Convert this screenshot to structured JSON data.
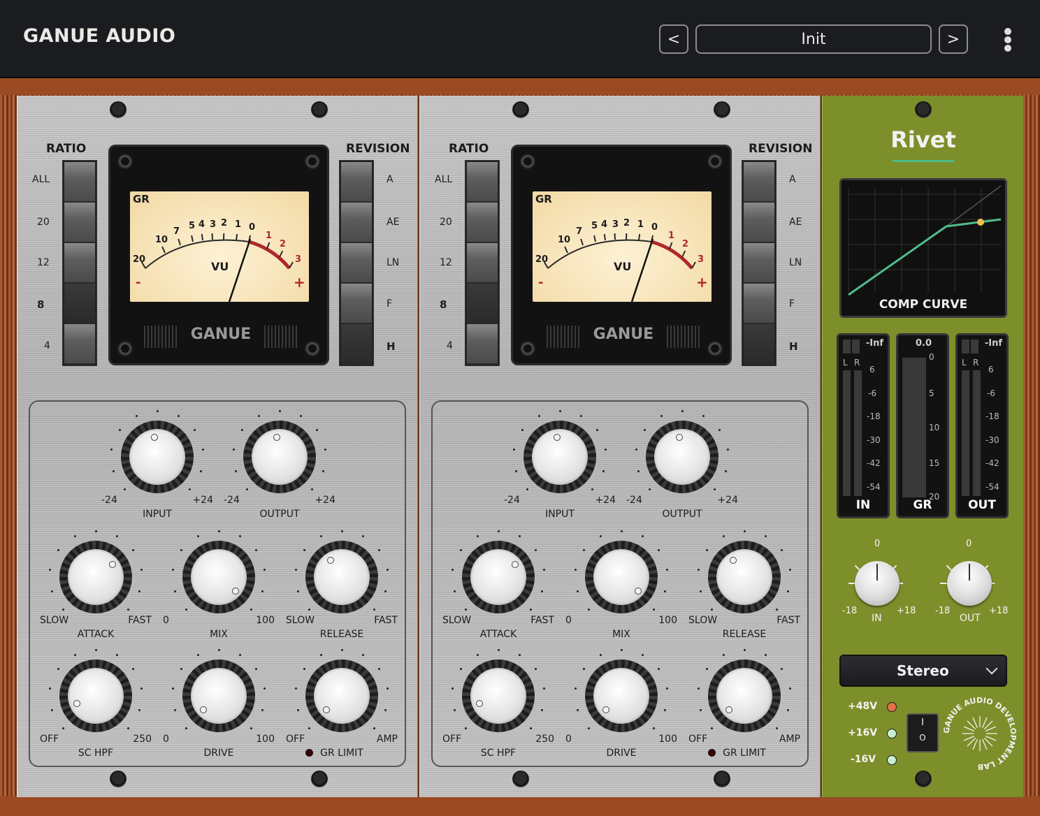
{
  "header": {
    "brand": "GANUE AUDIO",
    "prev_label": "<",
    "next_label": ">",
    "preset_name": "Init",
    "menu_icon": "vertical-dots-icon"
  },
  "channels": [
    {
      "ratio": {
        "title": "RATIO",
        "options": [
          "ALL",
          "20",
          "12",
          "8",
          "4"
        ],
        "selected": "8"
      },
      "revision": {
        "title": "REVISION",
        "options": [
          "A",
          "AE",
          "LN",
          "F",
          "H"
        ],
        "selected": "H"
      },
      "meter": {
        "gr": "GR",
        "scale": [
          "20",
          "10",
          "7",
          "5",
          "4",
          "3",
          "2",
          "1",
          "0",
          "1",
          "2",
          "3"
        ],
        "vu": "VU",
        "minus": "-",
        "plus": "+",
        "brand": "GANUE"
      },
      "knobs": {
        "input": {
          "label": "INPUT",
          "min": "-24",
          "max": "+24"
        },
        "output": {
          "label": "OUTPUT",
          "min": "-24",
          "max": "+24"
        },
        "attack": {
          "label": "ATTACK",
          "min": "SLOW",
          "max": "FAST"
        },
        "mix": {
          "label": "MIX",
          "min": "0",
          "max": "100"
        },
        "release": {
          "label": "RELEASE",
          "min": "SLOW",
          "max": "FAST"
        },
        "schpf": {
          "label": "SC HPF",
          "min": "OFF",
          "max": "250"
        },
        "drive": {
          "label": "DRIVE",
          "min": "0",
          "max": "100"
        },
        "grlimit": {
          "label": "GR LIMIT",
          "min": "OFF",
          "max": "AMP"
        }
      }
    },
    {
      "ratio": {
        "title": "RATIO",
        "options": [
          "ALL",
          "20",
          "12",
          "8",
          "4"
        ],
        "selected": "8"
      },
      "revision": {
        "title": "REVISION",
        "options": [
          "A",
          "AE",
          "LN",
          "F",
          "H"
        ],
        "selected": "H"
      },
      "meter": {
        "gr": "GR",
        "scale": [
          "20",
          "10",
          "7",
          "5",
          "4",
          "3",
          "2",
          "1",
          "0",
          "1",
          "2",
          "3"
        ],
        "vu": "VU",
        "minus": "-",
        "plus": "+",
        "brand": "GANUE"
      },
      "knobs": {
        "input": {
          "label": "INPUT",
          "min": "-24",
          "max": "+24"
        },
        "output": {
          "label": "OUTPUT",
          "min": "-24",
          "max": "+24"
        },
        "attack": {
          "label": "ATTACK",
          "min": "SLOW",
          "max": "FAST"
        },
        "mix": {
          "label": "MIX",
          "min": "0",
          "max": "100"
        },
        "release": {
          "label": "RELEASE",
          "min": "SLOW",
          "max": "FAST"
        },
        "schpf": {
          "label": "SC HPF",
          "min": "OFF",
          "max": "250"
        },
        "drive": {
          "label": "DRIVE",
          "min": "0",
          "max": "100"
        },
        "grlimit": {
          "label": "GR LIMIT",
          "min": "OFF",
          "max": "AMP"
        }
      }
    }
  ],
  "side": {
    "title": "Rivet",
    "curve_label": "COMP CURVE",
    "meters": {
      "in": {
        "label": "IN",
        "top": "-Inf",
        "l": "L",
        "r": "R",
        "scale": [
          "6",
          "-6",
          "-18",
          "-30",
          "-42",
          "-54"
        ]
      },
      "gr": {
        "label": "GR",
        "top": "0.0",
        "scale": [
          "0",
          "5",
          "10",
          "15",
          "20"
        ]
      },
      "out": {
        "label": "OUT",
        "top": "-Inf",
        "l": "L",
        "r": "R",
        "scale": [
          "6",
          "-6",
          "-18",
          "-30",
          "-42",
          "-54"
        ]
      }
    },
    "in_knob": {
      "label": "IN",
      "center": "0",
      "min": "-18",
      "max": "+18"
    },
    "out_knob": {
      "label": "OUT",
      "center": "0",
      "min": "-18",
      "max": "+18"
    },
    "mode": "Stereo",
    "power": [
      "+48V",
      "+16V",
      "-16V"
    ],
    "switch_on": "I",
    "switch_off": "O",
    "logo_text": "GANUE AUDIO DEVELOPMENT LAB",
    "colors": {
      "accent": "#4fbd8a",
      "panel": "#7d8f2a",
      "led_48v": "#e8704a",
      "led_16v": "#c8f0d0"
    }
  }
}
